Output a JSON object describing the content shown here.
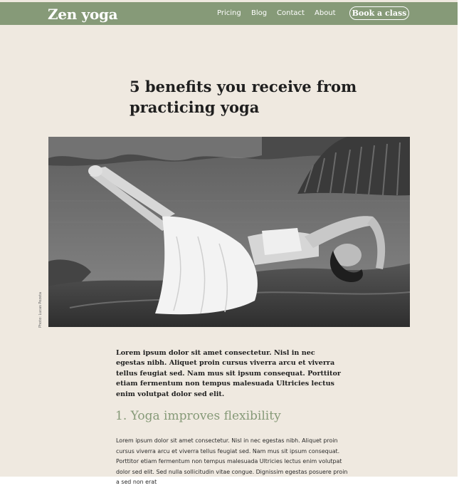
{
  "header": {
    "logo": "Zen yoga",
    "nav": [
      "Pricing",
      "Blog",
      "Contact",
      "About"
    ],
    "cta": "Book a class"
  },
  "article": {
    "title": "5 benefits you receive from practicing yoga",
    "photo_alt": "Woman in a yoga pose on a rock by the water",
    "photo_credit": "Photo: Lucas Pezeta",
    "lead": "Lorem ipsum dolor sit amet consectetur. Nisl in nec egestas nibh. Aliquet proin cursus viverra arcu et viverra tellus feugiat sed. Nam mus sit ipsum consequat. Porttitor etiam fermentum non tempus malesuada Ultricies lectus enim volutpat dolor sed elit.",
    "section_heading": "1. Yoga improves flexibility",
    "section_body": "Lorem ipsum dolor sit amet consectetur. Nisl in nec egestas nibh. Aliquet proin cursus viverra arcu et viverra tellus feugiat sed. Nam mus sit ipsum consequat. Porttitor etiam fermentum non tempus malesuada Ultricies lectus enim volutpat dolor sed elit. Sed nulla sollicitudin vitae congue. Dignissim egestas posuere proin a sed non erat"
  },
  "colors": {
    "accent": "#869a78",
    "background": "#efe9e0",
    "text": "#1f1f1f"
  }
}
